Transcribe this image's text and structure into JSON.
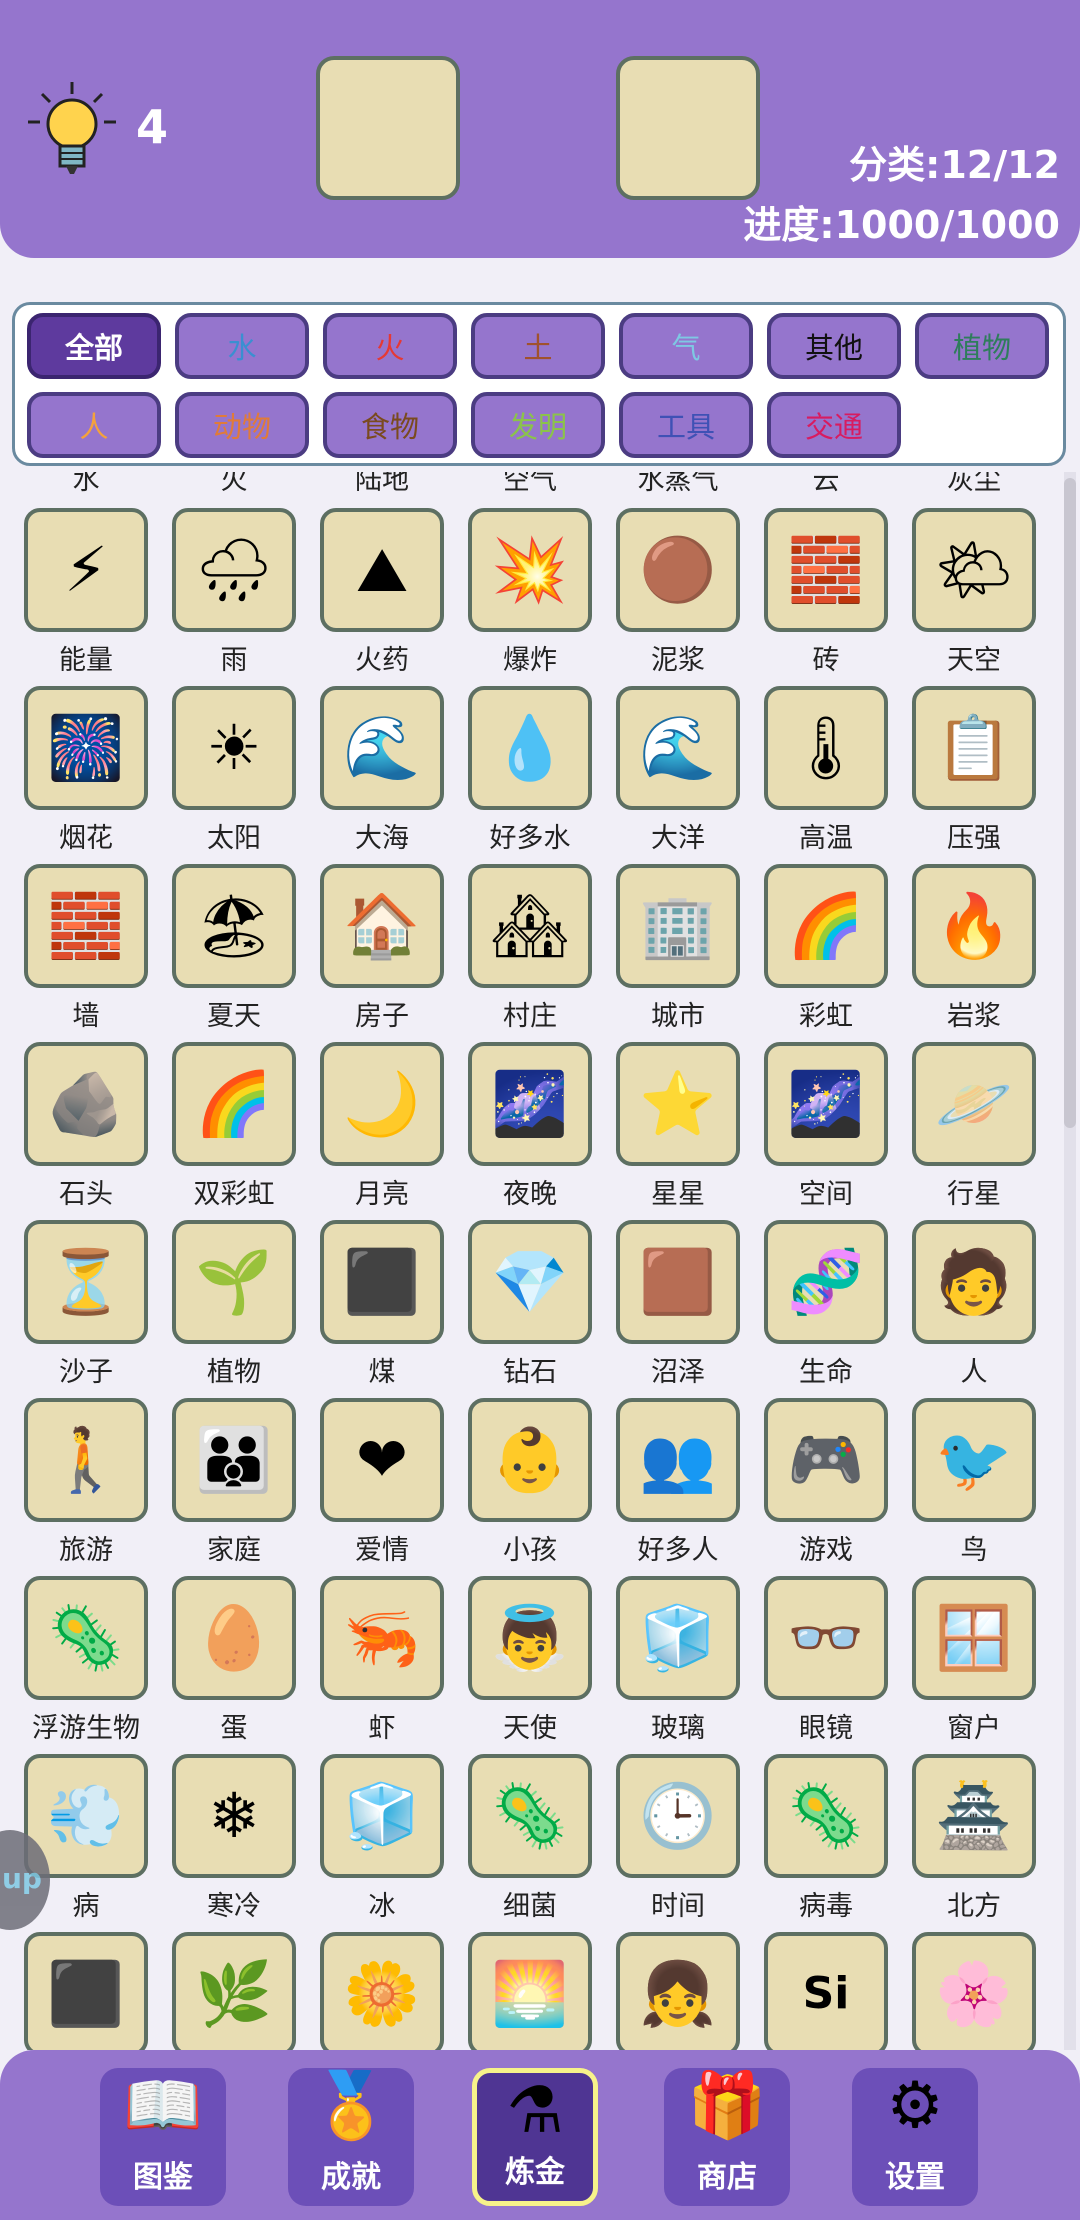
{
  "header": {
    "hint_count": "4",
    "category_text": "分类:12/12",
    "progress_text": "进度:1000/1000"
  },
  "filters": [
    {
      "label": "全部",
      "color": "#ffffff",
      "active": true
    },
    {
      "label": "水",
      "color": "#3a8fd1"
    },
    {
      "label": "火",
      "color": "#e53935"
    },
    {
      "label": "土",
      "color": "#a0522d"
    },
    {
      "label": "气",
      "color": "#7ec8e3"
    },
    {
      "label": "其他",
      "color": "#111111"
    },
    {
      "label": "植物",
      "color": "#2e7d5b"
    },
    {
      "label": "人",
      "color": "#f4a23c"
    },
    {
      "label": "动物",
      "color": "#e07b39"
    },
    {
      "label": "食物",
      "color": "#7a4a1e"
    },
    {
      "label": "发明",
      "color": "#8bc34a"
    },
    {
      "label": "工具",
      "color": "#3f51b5"
    },
    {
      "label": "交通",
      "color": "#d81b60"
    }
  ],
  "top_partial_labels": [
    "水",
    "火",
    "陆地",
    "空气",
    "水蒸气",
    "云",
    "灰尘"
  ],
  "items": [
    {
      "name": "能量",
      "icon": "energy-icon",
      "glyph": "⚡"
    },
    {
      "name": "雨",
      "icon": "rain-icon",
      "glyph": "🌧"
    },
    {
      "name": "火药",
      "icon": "gunpowder-icon",
      "glyph": "⛰"
    },
    {
      "name": "爆炸",
      "icon": "explosion-icon",
      "glyph": "💥"
    },
    {
      "name": "泥浆",
      "icon": "mud-icon",
      "glyph": "🟤"
    },
    {
      "name": "砖",
      "icon": "brick-icon",
      "glyph": "🧱"
    },
    {
      "name": "天空",
      "icon": "sky-icon",
      "glyph": "🌤"
    },
    {
      "name": "烟花",
      "icon": "fireworks-icon",
      "glyph": "🎆"
    },
    {
      "name": "太阳",
      "icon": "sun-icon",
      "glyph": "☀"
    },
    {
      "name": "大海",
      "icon": "sea-icon",
      "glyph": "🌊"
    },
    {
      "name": "好多水",
      "icon": "puddle-icon",
      "glyph": "💧"
    },
    {
      "name": "大洋",
      "icon": "ocean-icon",
      "glyph": "🌊"
    },
    {
      "name": "高温",
      "icon": "heat-icon",
      "glyph": "🌡"
    },
    {
      "name": "压强",
      "icon": "pressure-icon",
      "glyph": "📋"
    },
    {
      "name": "墙",
      "icon": "wall-icon",
      "glyph": "🧱"
    },
    {
      "name": "夏天",
      "icon": "summer-icon",
      "glyph": "🏖"
    },
    {
      "name": "房子",
      "icon": "house-icon",
      "glyph": "🏠"
    },
    {
      "name": "村庄",
      "icon": "village-icon",
      "glyph": "🏘"
    },
    {
      "name": "城市",
      "icon": "city-icon",
      "glyph": "🏢"
    },
    {
      "name": "彩虹",
      "icon": "rainbow-icon",
      "glyph": "🌈"
    },
    {
      "name": "岩浆",
      "icon": "lava-icon",
      "glyph": "🔥"
    },
    {
      "name": "石头",
      "icon": "stone-icon",
      "glyph": "🪨"
    },
    {
      "name": "双彩虹",
      "icon": "double-rainbow-icon",
      "glyph": "🌈"
    },
    {
      "name": "月亮",
      "icon": "moon-icon",
      "glyph": "🌙"
    },
    {
      "name": "夜晚",
      "icon": "night-icon",
      "glyph": "🌌"
    },
    {
      "name": "星星",
      "icon": "star-icon",
      "glyph": "⭐"
    },
    {
      "name": "空间",
      "icon": "space-icon",
      "glyph": "🌌"
    },
    {
      "name": "行星",
      "icon": "planet-icon",
      "glyph": "🪐"
    },
    {
      "name": "沙子",
      "icon": "sand-icon",
      "glyph": "⏳"
    },
    {
      "name": "植物",
      "icon": "plant-icon",
      "glyph": "🌱"
    },
    {
      "name": "煤",
      "icon": "coal-icon",
      "glyph": "⬛"
    },
    {
      "name": "钻石",
      "icon": "diamond-icon",
      "glyph": "💎"
    },
    {
      "name": "沼泽",
      "icon": "swamp-icon",
      "glyph": "🟫"
    },
    {
      "name": "生命",
      "icon": "dna-icon",
      "glyph": "🧬"
    },
    {
      "name": "人",
      "icon": "person-icon",
      "glyph": "🧑"
    },
    {
      "name": "旅游",
      "icon": "travel-icon",
      "glyph": "🚶"
    },
    {
      "name": "家庭",
      "icon": "family-icon",
      "glyph": "👪"
    },
    {
      "name": "爱情",
      "icon": "love-icon",
      "glyph": "❤"
    },
    {
      "name": "小孩",
      "icon": "baby-icon",
      "glyph": "👶"
    },
    {
      "name": "好多人",
      "icon": "crowd-icon",
      "glyph": "👥"
    },
    {
      "name": "游戏",
      "icon": "gamepad-icon",
      "glyph": "🎮"
    },
    {
      "name": "鸟",
      "icon": "bird-icon",
      "glyph": "🐦"
    },
    {
      "name": "浮游生物",
      "icon": "plankton-icon",
      "glyph": "🦠"
    },
    {
      "name": "蛋",
      "icon": "egg-icon",
      "glyph": "🥚"
    },
    {
      "name": "虾",
      "icon": "shrimp-icon",
      "glyph": "🦐"
    },
    {
      "name": "天使",
      "icon": "angel-icon",
      "glyph": "👼"
    },
    {
      "name": "玻璃",
      "icon": "glass-icon",
      "glyph": "🧊"
    },
    {
      "name": "眼镜",
      "icon": "glasses-icon",
      "glyph": "👓"
    },
    {
      "name": "窗户",
      "icon": "window-icon",
      "glyph": "🪟"
    },
    {
      "name": "病",
      "icon": "sickness-icon",
      "glyph": "💨"
    },
    {
      "name": "寒冷",
      "icon": "cold-icon",
      "glyph": "❄"
    },
    {
      "name": "冰",
      "icon": "ice-icon",
      "glyph": "🧊"
    },
    {
      "name": "细菌",
      "icon": "bacteria-icon",
      "glyph": "🦠"
    },
    {
      "name": "时间",
      "icon": "clock-icon",
      "glyph": "🕒"
    },
    {
      "name": "病毒",
      "icon": "virus-icon",
      "glyph": "🦠"
    },
    {
      "name": "北方",
      "icon": "temple-icon",
      "glyph": "🏯"
    }
  ],
  "partial_row": [
    {
      "icon": "dark-space-icon",
      "glyph": "⬛"
    },
    {
      "icon": "leaf-icon",
      "glyph": "🌿"
    },
    {
      "icon": "flowers-icon",
      "glyph": "🌼"
    },
    {
      "icon": "sunrise-icon",
      "glyph": "🌅"
    },
    {
      "icon": "girl-phone-icon",
      "glyph": "👧"
    },
    {
      "icon": "silicon-icon",
      "glyph": "Si"
    },
    {
      "icon": "cotton-icon",
      "glyph": "🌸"
    }
  ],
  "side_tab_text": "up",
  "nav": [
    {
      "label": "图鉴",
      "icon": "book-icon",
      "glyph": "📖"
    },
    {
      "label": "成就",
      "icon": "medal-icon",
      "glyph": "🏅"
    },
    {
      "label": "炼金",
      "icon": "flask-icon",
      "glyph": "⚗",
      "active": true
    },
    {
      "label": "商店",
      "icon": "gift-icon",
      "glyph": "🎁"
    },
    {
      "label": "设置",
      "icon": "gear-icon",
      "glyph": "⚙"
    }
  ]
}
